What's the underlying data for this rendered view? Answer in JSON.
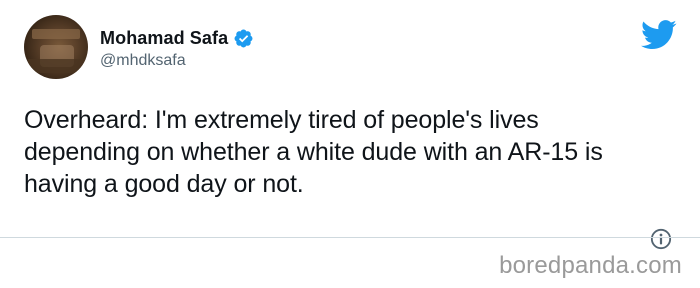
{
  "tweet": {
    "author_name": "Mohamad Safa",
    "author_handle": "@mhdksafa",
    "text": "Overheard: I'm extremely tired of people's lives depending on whether a white dude with an AR-15 is having a good day or not.",
    "verified_icon": "verified-badge-icon",
    "platform_icon": "twitter-bird-icon",
    "info_icon": "info-icon"
  },
  "watermark": {
    "text": "boredpanda.com"
  },
  "colors": {
    "accent": "#1d9bf0",
    "text": "#0f1419",
    "secondary_text": "#536471",
    "watermark": "#9a9a9a"
  }
}
